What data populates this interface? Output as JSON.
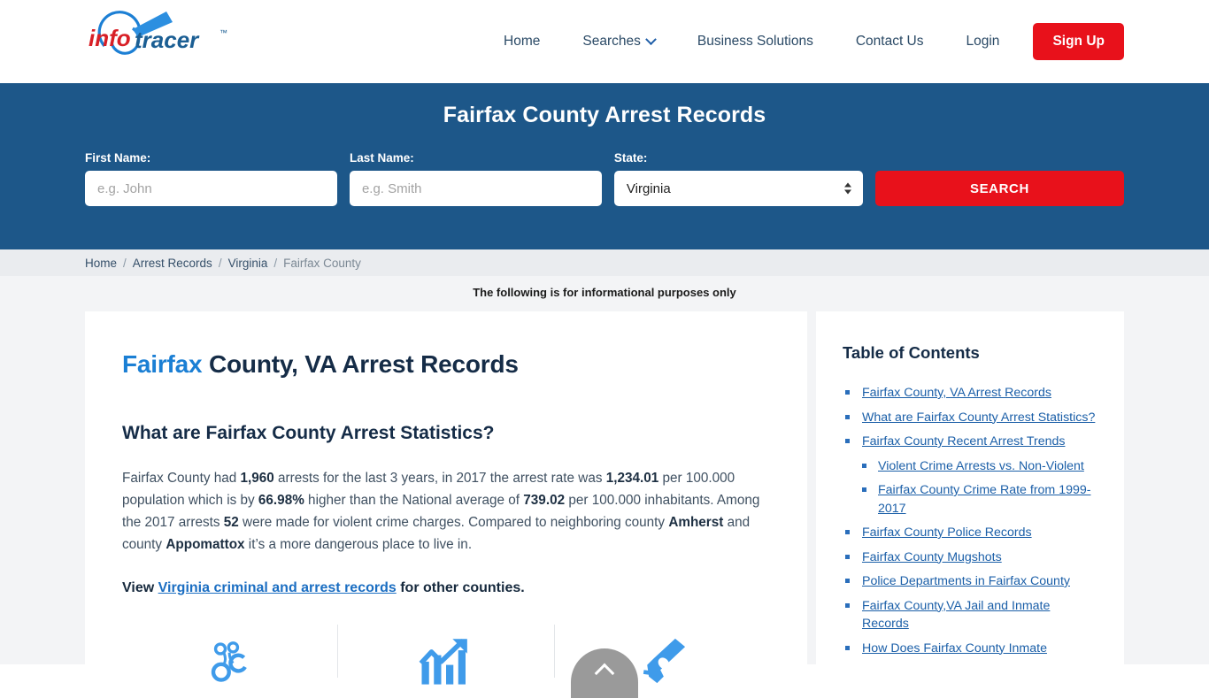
{
  "brand": {
    "name": "infotracer",
    "part1": "info",
    "part2": "tracer",
    "trademark": "™"
  },
  "nav": {
    "items": [
      {
        "label": "Home",
        "has_caret": false
      },
      {
        "label": "Searches",
        "has_caret": true
      },
      {
        "label": "Business Solutions",
        "has_caret": false
      },
      {
        "label": "Contact Us",
        "has_caret": false
      },
      {
        "label": "Login",
        "has_caret": false
      }
    ],
    "signup_label": "Sign Up"
  },
  "banner": {
    "title": "Fairfax County Arrest Records",
    "first_name_label": "First Name:",
    "first_name_placeholder": "e.g. John",
    "first_name_value": "",
    "last_name_label": "Last Name:",
    "last_name_placeholder": "e.g. Smith",
    "last_name_value": "",
    "state_label": "State:",
    "state_value": "Virginia",
    "search_label": "SEARCH"
  },
  "breadcrumb": {
    "items": [
      "Home",
      "Arrest Records",
      "Virginia",
      "Fairfax County"
    ],
    "separator": "/"
  },
  "notice": "The following is for informational purposes only",
  "main": {
    "title_highlight": "Fairfax",
    "title_rest": " County, VA Arrest Records",
    "section_title": "What are Fairfax County Arrest Statistics?",
    "paragraph": {
      "s1": "Fairfax County had ",
      "b1": "1,960",
      "s2": " arrests for the last 3 years, in 2017 the arrest rate was ",
      "b2": "1,234.01",
      "s3": " per 100.000 population which is by ",
      "b3": "66.98%",
      "s4": " higher than the National average of ",
      "b4": "739.02",
      "s5": " per 100.000 inhabitants. Among the 2017 arrests ",
      "b5": "52",
      "s6": " were made for violent crime charges. Compared to neighboring county ",
      "b6": "Amherst",
      "s7": " and county ",
      "b7": "Appomattox",
      "s8": " it’s a more dangerous place to live in."
    },
    "view_prefix": "View ",
    "view_link": "Virginia criminal and arrest records",
    "view_suffix": " for other counties.",
    "icons": [
      "handcuffs-icon",
      "trending-chart-icon",
      "handgun-icon"
    ]
  },
  "toc": {
    "title": "Table of Contents",
    "items": [
      {
        "label": "Fairfax County, VA Arrest Records",
        "sub": false
      },
      {
        "label": "What are Fairfax County Arrest Statistics?",
        "sub": false
      },
      {
        "label": "Fairfax County Recent Arrest Trends",
        "sub": false
      },
      {
        "label": "Violent Crime Arrests vs. Non-Violent",
        "sub": true
      },
      {
        "label": "Fairfax County Crime Rate from 1999-2017",
        "sub": true
      },
      {
        "label": "Fairfax County Police Records",
        "sub": false
      },
      {
        "label": "Fairfax County Mugshots",
        "sub": false
      },
      {
        "label": "Police Departments in Fairfax County",
        "sub": false
      },
      {
        "label": "Fairfax County,VA Jail and Inmate Records",
        "sub": false
      },
      {
        "label": "How Does Fairfax County Inmate",
        "sub": false
      }
    ]
  },
  "scroll_top": {
    "icon": "chevron-up-icon"
  },
  "colors": {
    "banner_blue": "#1d5789",
    "accent_red": "#e8111b",
    "link_blue": "#1b5fa8",
    "title_navy": "#152c47",
    "highlight_blue": "#1b7fd4",
    "page_bg": "#f3f4f6",
    "breadcrumb_bg": "#eaecef"
  }
}
